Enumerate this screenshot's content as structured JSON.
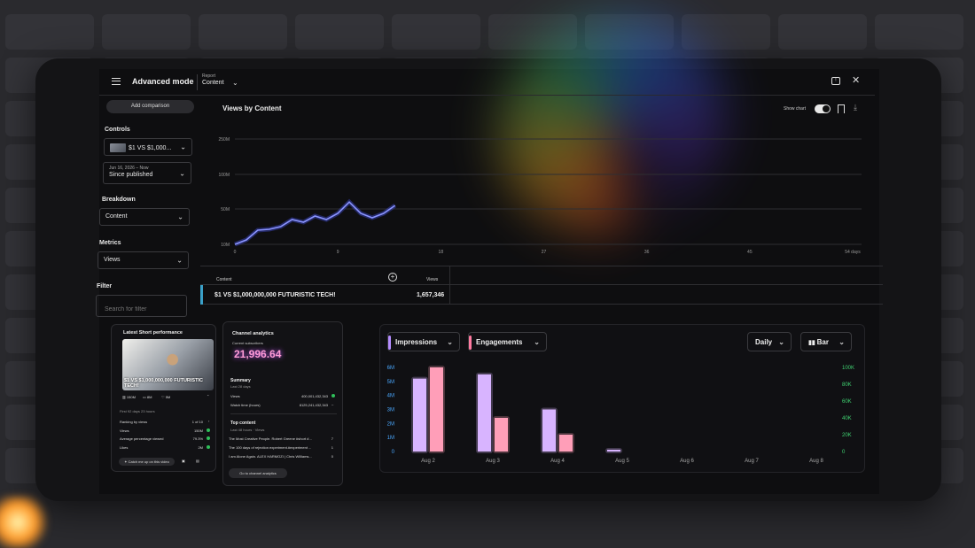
{
  "header": {
    "title": "Advanced mode",
    "report_label": "Report",
    "report_value": "Content"
  },
  "sidebar": {
    "add_comparison": "Add comparison",
    "controls_label": "Controls",
    "controls_video": "$1 VS $1,000...",
    "date_range_small": "Jun 16, 2026 – Now",
    "date_range": "Since published",
    "breakdown_label": "Breakdown",
    "breakdown_value": "Content",
    "metrics_label": "Metrics",
    "metrics_value": "Views",
    "filter_label": "Filter",
    "filter_placeholder": "Search for filter"
  },
  "chart": {
    "title": "Views by Content",
    "show_chart_label": "Show chart"
  },
  "chart_data": [
    {
      "type": "line",
      "title": "Views by Content",
      "y_ticks": [
        "10M",
        "50M",
        "100M",
        "250M"
      ],
      "x_ticks": [
        "0",
        "9",
        "18",
        "27",
        "36",
        "45",
        "54 days"
      ],
      "series": [
        {
          "x": [
            0,
            1,
            2,
            3,
            4,
            5,
            6,
            7,
            8,
            9,
            10,
            11,
            12,
            13,
            14
          ],
          "y": [
            10,
            15,
            26,
            27,
            30,
            38,
            35,
            42,
            38,
            45,
            60,
            45,
            40,
            45,
            55
          ]
        }
      ],
      "color": "#6f7cff"
    },
    {
      "type": "bar",
      "categories": [
        "Aug 2",
        "Aug 3",
        "Aug 4",
        "Aug 5",
        "Aug 6",
        "Aug 7",
        "Aug 8"
      ],
      "series": [
        {
          "name": "Impressions",
          "values": [
            5.2,
            5.5,
            3.0,
            0.1,
            0,
            0,
            0
          ],
          "color": "#d8b4ff"
        },
        {
          "name": "Engagements",
          "values": [
            100,
            40,
            20,
            0,
            0,
            0,
            0
          ],
          "color": "#ff9eb8"
        }
      ],
      "y_left_ticks": [
        "0",
        "1M",
        "2M",
        "3M",
        "4M",
        "5M",
        "6M"
      ],
      "y_right_ticks": [
        "0",
        "20K",
        "40K",
        "60K",
        "80K",
        "100K"
      ],
      "ylim_left": [
        0,
        6
      ],
      "ylim_right": [
        0,
        100
      ]
    }
  ],
  "table": {
    "col_content": "Content",
    "col_views": "Views",
    "row_name": "$1 VS $1,000,000,000 FUTURISTIC TECH!",
    "row_views": "1,657,346"
  },
  "short_card": {
    "title": "Latest Short performance",
    "thumb_text": "$1 VS $1,000,000,000 FUTURISTIC TECH!",
    "stat_views": "150M",
    "stat_comments": "8M",
    "stat_likes": "5M",
    "period": "First 92 days 23 hours",
    "ranking_label": "Ranking by views",
    "ranking_value": "1 of 10",
    "views_label": "Views",
    "views_value": "150M",
    "avg_label": "Average percentage viewed",
    "avg_value": "79.3%",
    "likes_label": "Likes",
    "likes_value": "2M",
    "catch_up": "Catch me up on this video"
  },
  "channel_card": {
    "title": "Channel analytics",
    "subs_label": "Current subscribers",
    "subs_value": "21,996.64",
    "summary_label": "Summary",
    "summary_period": "Last 28 days",
    "views_label": "Views",
    "views_value": "400,001,432,343",
    "watch_label": "Watch time (hours)",
    "watch_value": "8125,241,432,343",
    "top_label": "Top content",
    "top_period": "Last 48 hours · Views",
    "top_items": [
      {
        "name": "The Most Creative People. Robert Greene #short #...",
        "value": "7"
      },
      {
        "name": "The 100 days of rejection experiment.#experiment ...",
        "value": "1"
      },
      {
        "name": "I am Alone Again. ALEX HARMOZI | Chris Williams...",
        "value": "0"
      }
    ],
    "go_button": "Go to channel analytics"
  },
  "bar_panel": {
    "impressions": "Impressions",
    "engagements": "Engagements",
    "period": "Daily",
    "chart_type": "Bar"
  }
}
